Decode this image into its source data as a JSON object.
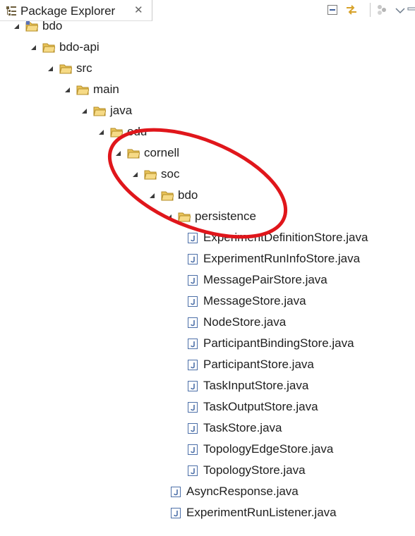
{
  "view": {
    "title": "Package Explorer",
    "close_glyph": "✕",
    "toolbar": [
      "collapse-all-icon",
      "link-with-editor-icon",
      "focus-on-active-task-icon",
      "view-menu-icon",
      "minimize-icon"
    ]
  },
  "tree": [
    {
      "label": "bdo",
      "kind": "project",
      "depth": 0,
      "expanded": true
    },
    {
      "label": "bdo-api",
      "kind": "folder",
      "depth": 1,
      "expanded": true
    },
    {
      "label": "src",
      "kind": "folder",
      "depth": 2,
      "expanded": true
    },
    {
      "label": "main",
      "kind": "folder",
      "depth": 3,
      "expanded": true
    },
    {
      "label": "java",
      "kind": "folder",
      "depth": 4,
      "expanded": true
    },
    {
      "label": "edu",
      "kind": "folder",
      "depth": 5,
      "expanded": true
    },
    {
      "label": "cornell",
      "kind": "folder",
      "depth": 6,
      "expanded": true
    },
    {
      "label": "soc",
      "kind": "folder",
      "depth": 7,
      "expanded": true
    },
    {
      "label": "bdo",
      "kind": "folder",
      "depth": 8,
      "expanded": true
    },
    {
      "label": "persistence",
      "kind": "folder",
      "depth": 9,
      "expanded": true
    },
    {
      "label": "ExperimentDefinitionStore.java",
      "kind": "java",
      "depth": 10
    },
    {
      "label": "ExperimentRunInfoStore.java",
      "kind": "java",
      "depth": 10
    },
    {
      "label": "MessagePairStore.java",
      "kind": "java",
      "depth": 10
    },
    {
      "label": "MessageStore.java",
      "kind": "java",
      "depth": 10
    },
    {
      "label": "NodeStore.java",
      "kind": "java",
      "depth": 10
    },
    {
      "label": "ParticipantBindingStore.java",
      "kind": "java",
      "depth": 10
    },
    {
      "label": "ParticipantStore.java",
      "kind": "java",
      "depth": 10
    },
    {
      "label": "TaskInputStore.java",
      "kind": "java",
      "depth": 10
    },
    {
      "label": "TaskOutputStore.java",
      "kind": "java",
      "depth": 10
    },
    {
      "label": "TaskStore.java",
      "kind": "java",
      "depth": 10
    },
    {
      "label": "TopologyEdgeStore.java",
      "kind": "java",
      "depth": 10
    },
    {
      "label": "TopologyStore.java",
      "kind": "java",
      "depth": 10
    },
    {
      "label": "AsyncResponse.java",
      "kind": "java",
      "depth": 9
    },
    {
      "label": "ExperimentRunListener.java",
      "kind": "java",
      "depth": 9
    }
  ],
  "colors": {
    "annotation": "#e0161b",
    "folder": "#e9c35a",
    "java": "#4c6fa8"
  }
}
